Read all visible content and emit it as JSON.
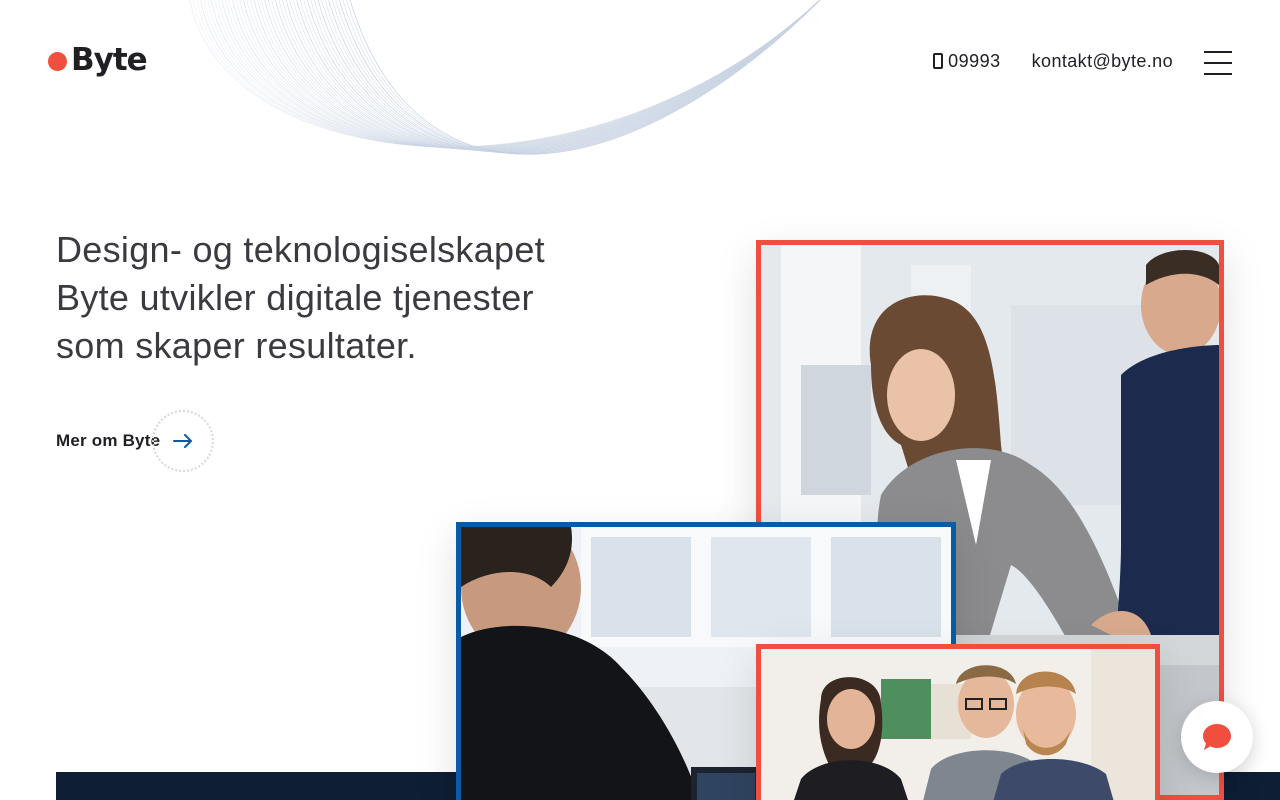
{
  "brand": {
    "name": "Byte",
    "accent_color": "#f04e3e",
    "blue_color": "#0b5aa6",
    "dark_color": "#0e1e35"
  },
  "header": {
    "phone": "09993",
    "phone_icon": "mobile-phone-icon",
    "email": "kontakt@byte.no",
    "menu_icon": "hamburger-menu-icon"
  },
  "hero": {
    "lines": [
      "Design- og teknologiselskapet",
      "Byte utvikler digitale tjenester",
      "som skaper resultater."
    ],
    "cta_label": "Mer om Byte",
    "cta_icon": "arrow-right-icon"
  },
  "photos": [
    {
      "name": "team-photo-woman-and-man-at-desk",
      "frame_color": "#f04e3e"
    },
    {
      "name": "team-photo-man-at-monitor",
      "frame_color": "#0b5aa6"
    },
    {
      "name": "team-photo-three-colleagues",
      "frame_color": "#f04e3e"
    }
  ],
  "chat": {
    "icon": "chat-bubble-icon"
  }
}
